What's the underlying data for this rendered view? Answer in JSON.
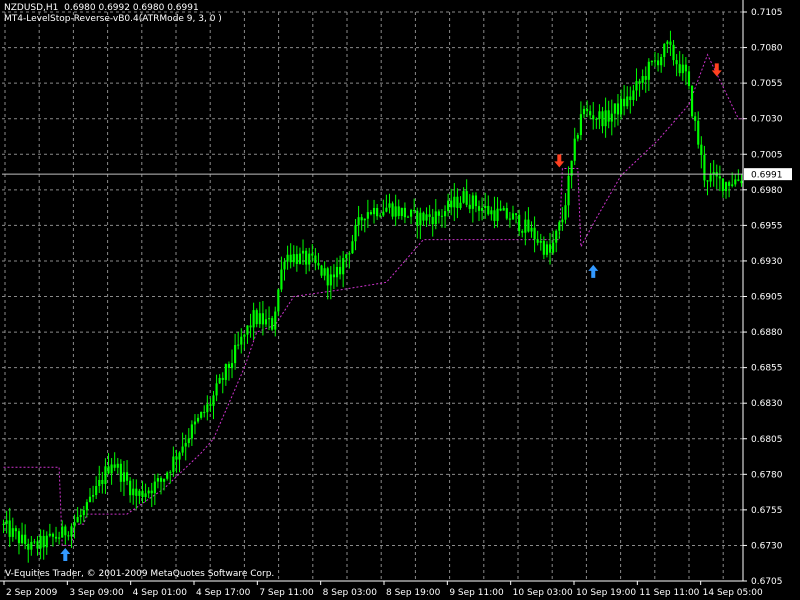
{
  "header": {
    "symbol_line": "NZDUSD,H1  0.6980 0.6992 0.6980 0.6991",
    "indicator_line": "MT4-LevelStop-Reverse-vB0.4(ATRMode 9, 3, 0 )"
  },
  "footer": {
    "copyright": "V-Equities Trader, © 2001-2009 MetaQuotes Software Corp."
  },
  "colors": {
    "background": "#000000",
    "grid": "#8a8a8a",
    "axis": "#ffffff",
    "candle": "#00ff00",
    "stop_line": "#cc33cc",
    "buy_arrow": "#3399ff",
    "sell_arrow": "#ff4020",
    "current_price_line": "#c0c0c0"
  },
  "icons": {
    "buy_signal": "arrow-up-icon",
    "sell_signal": "arrow-down-icon"
  },
  "chart_data": {
    "type": "candlestick",
    "symbol": "NZDUSD",
    "timeframe": "H1",
    "current_price": "0.6991",
    "ylim": [
      0.6705,
      0.7105
    ],
    "y_ticks": [
      "0.7105",
      "0.7080",
      "0.7055",
      "0.7030",
      "0.7005",
      "0.6980",
      "0.6955",
      "0.6930",
      "0.6905",
      "0.6880",
      "0.6855",
      "0.6830",
      "0.6805",
      "0.6780",
      "0.6755",
      "0.6730",
      "0.6705"
    ],
    "x_ticks": [
      "2 Sep 2009",
      "3 Sep 09:00",
      "4 Sep 01:00",
      "4 Sep 17:00",
      "7 Sep 11:00",
      "8 Sep 03:00",
      "8 Sep 19:00",
      "9 Sep 11:00",
      "10 Sep 03:00",
      "10 Sep 19:00",
      "11 Sep 11:00",
      "14 Sep 05:00"
    ],
    "bar_count": 240,
    "price_path": [
      [
        0,
        0.6745
      ],
      [
        10,
        0.6728
      ],
      [
        20,
        0.6738
      ],
      [
        28,
        0.6755
      ],
      [
        36,
        0.679
      ],
      [
        44,
        0.6765
      ],
      [
        52,
        0.6775
      ],
      [
        60,
        0.6805
      ],
      [
        68,
        0.683
      ],
      [
        76,
        0.6865
      ],
      [
        82,
        0.689
      ],
      [
        88,
        0.6885
      ],
      [
        92,
        0.6935
      ],
      [
        100,
        0.693
      ],
      [
        108,
        0.6915
      ],
      [
        112,
        0.6935
      ],
      [
        118,
        0.6965
      ],
      [
        126,
        0.6968
      ],
      [
        134,
        0.696
      ],
      [
        142,
        0.6962
      ],
      [
        150,
        0.6975
      ],
      [
        158,
        0.6965
      ],
      [
        166,
        0.696
      ],
      [
        172,
        0.695
      ],
      [
        178,
        0.6935
      ],
      [
        182,
        0.696
      ],
      [
        188,
        0.7035
      ],
      [
        196,
        0.703
      ],
      [
        204,
        0.7045
      ],
      [
        210,
        0.7065
      ],
      [
        216,
        0.708
      ],
      [
        222,
        0.706
      ],
      [
        228,
        0.699
      ],
      [
        234,
        0.6985
      ],
      [
        240,
        0.6988
      ]
    ],
    "stop_line": [
      [
        0,
        0.6785
      ],
      [
        18,
        0.6785
      ],
      [
        19,
        0.673
      ],
      [
        22,
        0.673
      ],
      [
        23,
        0.6745
      ],
      [
        26,
        0.6745
      ],
      [
        27,
        0.6752
      ],
      [
        40,
        0.6752
      ],
      [
        52,
        0.677
      ],
      [
        64,
        0.6795
      ],
      [
        68,
        0.6805
      ],
      [
        78,
        0.6855
      ],
      [
        82,
        0.688
      ],
      [
        88,
        0.6885
      ],
      [
        94,
        0.6905
      ],
      [
        110,
        0.691
      ],
      [
        124,
        0.6915
      ],
      [
        136,
        0.6945
      ],
      [
        144,
        0.6945
      ],
      [
        180,
        0.6945
      ],
      [
        181,
        0.6995
      ],
      [
        186,
        0.6995
      ],
      [
        187,
        0.694
      ],
      [
        192,
        0.696
      ],
      [
        200,
        0.699
      ],
      [
        212,
        0.7015
      ],
      [
        222,
        0.704
      ],
      [
        228,
        0.7075
      ],
      [
        238,
        0.703
      ],
      [
        240,
        0.703
      ]
    ],
    "signals": [
      {
        "type": "buy",
        "bar": 20,
        "price": 0.6724
      },
      {
        "type": "sell",
        "bar": 180,
        "price": 0.7
      },
      {
        "type": "buy",
        "bar": 191,
        "price": 0.6923
      },
      {
        "type": "sell",
        "bar": 231,
        "price": 0.7064
      }
    ]
  }
}
